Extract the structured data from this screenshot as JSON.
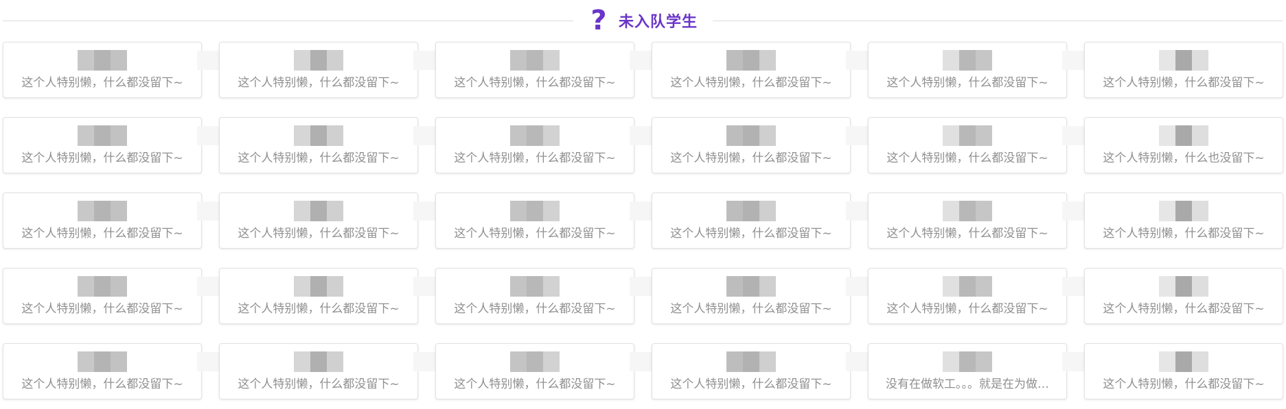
{
  "section": {
    "icon": "question-mark-icon",
    "title": "未入队学生",
    "accent_color": "#6a35c8"
  },
  "cards": [
    {
      "description": "这个人特别懒，什么都没留下~"
    },
    {
      "description": "这个人特别懒，什么都没留下~"
    },
    {
      "description": "这个人特别懒，什么都没留下~"
    },
    {
      "description": "这个人特别懒，什么都没留下~"
    },
    {
      "description": "这个人特别懒，什么都没留下~"
    },
    {
      "description": "这个人特别懒，什么都没留下~"
    },
    {
      "description": "这个人特别懒，什么都没留下~"
    },
    {
      "description": "这个人特别懒，什么都没留下~"
    },
    {
      "description": "这个人特别懒，什么都没留下~"
    },
    {
      "description": "这个人特别懒，什么都没留下~"
    },
    {
      "description": "这个人特别懒，什么都没留下~"
    },
    {
      "description": "这个人特别懒，什么也没留下~"
    },
    {
      "description": "这个人特别懒，什么都没留下~"
    },
    {
      "description": "这个人特别懒，什么都没留下~"
    },
    {
      "description": "这个人特别懒，什么都没留下~"
    },
    {
      "description": "这个人特别懒，什么都没留下~"
    },
    {
      "description": "这个人特别懒，什么都没留下~"
    },
    {
      "description": "这个人特别懒，什么都没留下~"
    },
    {
      "description": "这个人特别懒，什么都没留下~"
    },
    {
      "description": "这个人特别懒，什么都没留下~"
    },
    {
      "description": "这个人特别懒，什么都没留下~"
    },
    {
      "description": "这个人特别懒，什么都没留下~"
    },
    {
      "description": "这个人特别懒，什么都没留下~"
    },
    {
      "description": "这个人特别懒，什么都没留下~"
    },
    {
      "description": "这个人特别懒，什么都没留下~"
    },
    {
      "description": "这个人特别懒，什么都没留下~"
    },
    {
      "description": "这个人特别懒，什么都没留下~"
    },
    {
      "description": "这个人特别懒，什么都没留下~"
    },
    {
      "description": "没有在做软工。。。就是在为做…"
    },
    {
      "description": "这个人特别懒，什么都没留下~"
    }
  ]
}
